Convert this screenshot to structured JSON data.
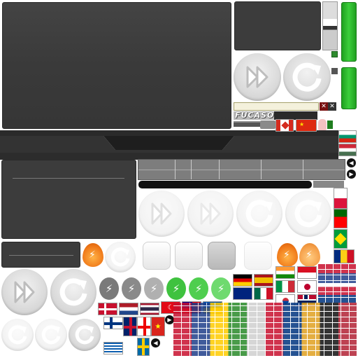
{
  "brand": {
    "logo_text": "FUCASO"
  },
  "icons": {
    "forward": "fast-forward-icon",
    "refresh": "refresh-icon",
    "lightning": "lightning-icon",
    "close": "close-icon",
    "arrow_left": "arrow-left-icon",
    "arrow_right": "arrow-right-icon"
  },
  "colors": {
    "panel_dark": "#3c3c3c",
    "green_bar": "#2bb52b",
    "flame_orange": "#f07a1a",
    "lightning_green": "#3fc23f",
    "lightning_gray": "#7a7a7a"
  },
  "flags": [
    "Canada",
    "China",
    "Germany",
    "Spain",
    "India",
    "Denmark",
    "Netherlands",
    "Thailand",
    "Turkey",
    "Taiwan",
    "Ukraine",
    "Australia",
    "Mexico",
    "Italy",
    "Japan",
    "Finland",
    "United Kingdom",
    "Georgia",
    "Vietnam",
    "Greece",
    "Sweden",
    "South Korea",
    "Norway",
    "Portugal",
    "Brazil",
    "Romania",
    "Bulgaria",
    "Hungary",
    "Poland"
  ]
}
